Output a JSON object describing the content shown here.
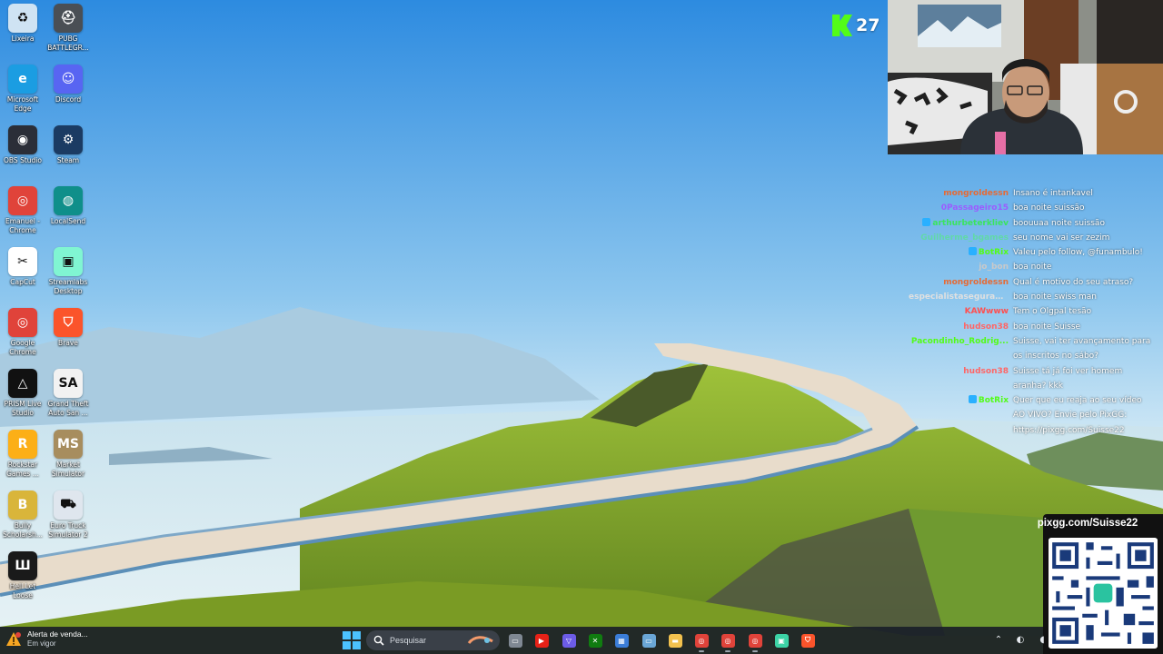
{
  "desktop": {
    "icons": [
      {
        "label": "Lixeira",
        "icon": "recycle-bin-icon",
        "color": "#cfe3f3",
        "glyph": "♻"
      },
      {
        "label": "PUBG BATTLEGR...",
        "icon": "pubg-icon",
        "color": "#4a4f55",
        "glyph": "⛑"
      },
      {
        "label": "Microsoft Edge",
        "icon": "edge-icon",
        "color": "#1b9de2",
        "glyph": "e"
      },
      {
        "label": "Discord",
        "icon": "discord-icon",
        "color": "#5865f2",
        "glyph": "☺"
      },
      {
        "label": "OBS Studio",
        "icon": "obs-icon",
        "color": "#2b2e38",
        "glyph": "◉"
      },
      {
        "label": "Steam",
        "icon": "steam-icon",
        "color": "#1b3b63",
        "glyph": "⚙"
      },
      {
        "label": "Emanuel - Chrome",
        "icon": "chrome-profile-icon",
        "color": "#e0433a",
        "glyph": "◎"
      },
      {
        "label": "LocalSend",
        "icon": "localsend-icon",
        "color": "#0f8f8a",
        "glyph": "◍"
      },
      {
        "label": "CapCut",
        "icon": "capcut-icon",
        "color": "#ffffff",
        "glyph": "✂"
      },
      {
        "label": "Streamlabs Desktop",
        "icon": "streamlabs-icon",
        "color": "#80f5d2",
        "glyph": "▣"
      },
      {
        "label": "Google Chrome",
        "icon": "chrome-icon",
        "color": "#e0433a",
        "glyph": "◎"
      },
      {
        "label": "Brave",
        "icon": "brave-icon",
        "color": "#fb542b",
        "glyph": "⛉"
      },
      {
        "label": "PRISM Live Studio",
        "icon": "prism-icon",
        "color": "#111111",
        "glyph": "△"
      },
      {
        "label": "Grand Theft Auto San ...",
        "icon": "gta-sa-icon",
        "color": "#f2f2f2",
        "glyph": "SA"
      },
      {
        "label": "Rockstar Games ...",
        "icon": "rockstar-icon",
        "color": "#fcaf17",
        "glyph": "R"
      },
      {
        "label": "Market Simulator",
        "icon": "market-simulator-icon",
        "color": "#a78d5e",
        "glyph": "MS"
      },
      {
        "label": "Bully Scholarsh...",
        "icon": "bully-icon",
        "color": "#d9b53a",
        "glyph": "B"
      },
      {
        "label": "Euro Truck Simulator 2",
        "icon": "euro-truck-icon",
        "color": "#dfe6ee",
        "glyph": "⛟"
      },
      {
        "label": "Hell Let Loose",
        "icon": "hell-let-loose-icon",
        "color": "#1a1a1a",
        "glyph": "Ш"
      }
    ]
  },
  "kick": {
    "count": "27",
    "brand_color": "#53fc18"
  },
  "chat": {
    "messages": [
      {
        "user": "mongroldessn",
        "color": "#e66a35",
        "text": "Insano é intankavel",
        "badge": ""
      },
      {
        "user": "0Passageiro15",
        "color": "#9b5cff",
        "text": "boa noite suissão",
        "badge": ""
      },
      {
        "user": "arthurbeterkliev",
        "color": "#3ae55c",
        "text": "boouuaa noite suissão",
        "badge": "#2ab0ff"
      },
      {
        "user": "Guilherme_bgames",
        "color": "#61d9a8",
        "text": "seu nome vai ser zezim",
        "badge": ""
      },
      {
        "user": "BotRix",
        "color": "#53fc18",
        "text": "Valeu pelo follow, @funambulo!",
        "badge": "#2ab0ff"
      },
      {
        "user": "jo_bon",
        "color": "#c9c9c9",
        "text": "boa noite",
        "badge": ""
      },
      {
        "user": "mongroldessn",
        "color": "#e66a35",
        "text": "Qual é motivo do seu atraso?",
        "badge": ""
      },
      {
        "user": "especialistaseguranc...",
        "color": "#e0e0e0",
        "text": "boa noite swiss man",
        "badge": ""
      },
      {
        "user": "KAWwww",
        "color": "#ff4f4f",
        "text": "Tem o Olgpal tesão",
        "badge": ""
      },
      {
        "user": "hudson38",
        "color": "#ff6666",
        "text": "boa noite Suisse",
        "badge": ""
      },
      {
        "user": "Pacondinho_Rodrig...",
        "color": "#53fc18",
        "text": "Suisse, vai ter avançamento para os inscritos no sábo?",
        "badge": ""
      },
      {
        "user": "hudson38",
        "color": "#ff6666",
        "text": "Suisse tá já foi ver homem aranha? kkk",
        "badge": ""
      },
      {
        "user": "BotRix",
        "color": "#53fc18",
        "text": "Quer que eu reaja ao seu vídeo AO VIVO? Envie pelo PixGG: https://pixgg.com/Suisse22",
        "badge": "#2ab0ff"
      }
    ]
  },
  "qr": {
    "url": "pixgg.com/Suisse22"
  },
  "taskbar": {
    "weather_title": "Alerta de venda...",
    "weather_sub": "Em vigor",
    "search_placeholder": "Pesquisar",
    "apps": [
      {
        "icon": "file-explorer-icon",
        "color": "#7f8893",
        "glyph": "▭"
      },
      {
        "icon": "youtube-icon",
        "color": "#e62117",
        "glyph": "▶"
      },
      {
        "icon": "vpn-icon",
        "color": "#6c5ce7",
        "glyph": "▽"
      },
      {
        "icon": "xbox-icon",
        "color": "#107c10",
        "glyph": "✕"
      },
      {
        "icon": "calculator-icon",
        "color": "#3b7dd8",
        "glyph": "▦"
      },
      {
        "icon": "monitor-icon",
        "color": "#6aa6d6",
        "glyph": "▭"
      },
      {
        "icon": "folder-icon",
        "color": "#f2c14e",
        "glyph": "▬"
      },
      {
        "icon": "chrome-taskbar-icon",
        "color": "#e0433a",
        "glyph": "◎"
      },
      {
        "icon": "chrome-profile-taskbar-icon",
        "color": "#e0433a",
        "glyph": "◎"
      },
      {
        "icon": "chrome-alt-taskbar-icon",
        "color": "#e0433a",
        "glyph": "◎"
      },
      {
        "icon": "streamlabs-taskbar-icon",
        "color": "#3cd3a6",
        "glyph": "▣"
      },
      {
        "icon": "brave-taskbar-icon",
        "color": "#fb542b",
        "glyph": "⛉"
      }
    ]
  }
}
